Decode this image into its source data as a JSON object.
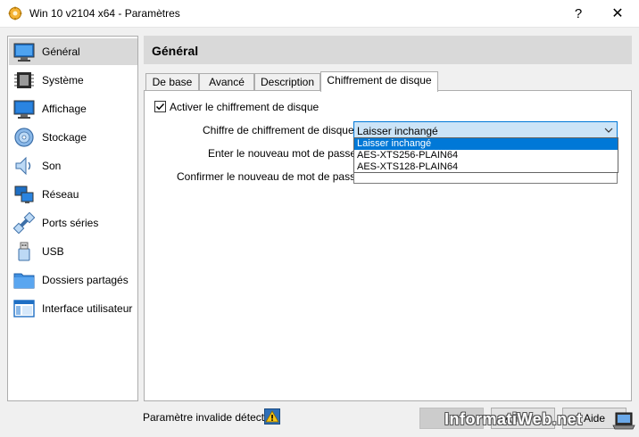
{
  "window": {
    "title": "Win 10 v2104 x64 - Paramètres",
    "help_label": "?",
    "close_label": "✕"
  },
  "sidebar": {
    "items": [
      {
        "label": "Général",
        "icon": "general-icon"
      },
      {
        "label": "Système",
        "icon": "system-icon"
      },
      {
        "label": "Affichage",
        "icon": "display-icon"
      },
      {
        "label": "Stockage",
        "icon": "storage-icon"
      },
      {
        "label": "Son",
        "icon": "audio-icon"
      },
      {
        "label": "Réseau",
        "icon": "network-icon"
      },
      {
        "label": "Ports séries",
        "icon": "serial-ports-icon"
      },
      {
        "label": "USB",
        "icon": "usb-icon"
      },
      {
        "label": "Dossiers partagés",
        "icon": "shared-folders-icon"
      },
      {
        "label": "Interface utilisateur",
        "icon": "user-interface-icon"
      }
    ],
    "active_index": 0
  },
  "header": {
    "title": "Général"
  },
  "tabs": [
    {
      "label": "De base"
    },
    {
      "label": "Avancé"
    },
    {
      "label": "Description"
    },
    {
      "label": "Chiffrement de disque"
    }
  ],
  "active_tab": 3,
  "encryption": {
    "enable_label": "Activer le chiffrement de disque",
    "enabled": true,
    "cipher_label": "Chiffre de chiffrement de disque :",
    "cipher_value": "Laisser inchangé",
    "cipher_options": [
      "Laisser inchangé",
      "AES-XTS256-PLAIN64",
      "AES-XTS128-PLAIN64"
    ],
    "new_password_label": "Enter le nouveau mot de passe :",
    "confirm_password_label": "Confirmer le nouveau de mot de passe :"
  },
  "footer": {
    "status_text": "Paramètre invalide détecté",
    "ok_label": "OK",
    "cancel_label": "Annuler",
    "help_label": "Aide"
  },
  "watermark": {
    "text": "InformatiWeb.net"
  }
}
